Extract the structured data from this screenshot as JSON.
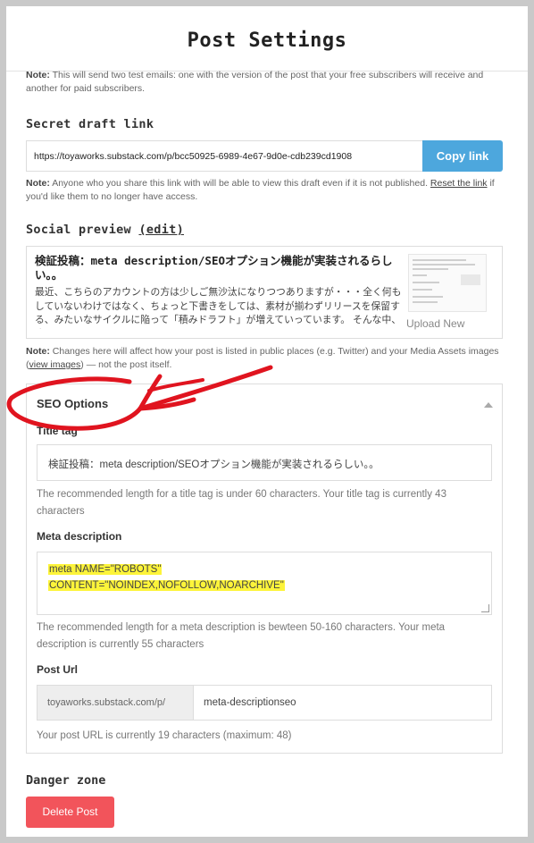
{
  "header": {
    "title": "Post Settings"
  },
  "email_note": {
    "label": "Note:",
    "text": "This will send two test emails: one with the version of the post that your free subscribers will receive and another for paid subscribers."
  },
  "secret_draft": {
    "title": "Secret draft link",
    "url": "https://toyaworks.substack.com/p/bcc50925-6989-4e67-9d0e-cdb239cd1908",
    "copy_label": "Copy link",
    "note_label": "Note:",
    "note_text_1": "Anyone who you share this link with will be able to view this draft even if it is not published.",
    "reset_link": "Reset the link",
    "note_text_2": "if you'd like them to no longer have access."
  },
  "social_preview": {
    "title": "Social preview",
    "edit_label": "(edit)",
    "post_title": "検証投稿：meta description/SEOオプション機能が実装されるらしい。。",
    "description": "最近、こちらのアカウントの方は少しご無沙汰になりつつありますが・・・全く何もしていないわけではなく、ちょっと下書きをしては、素材が揃わずリリースを保留する、みたいなサイクルに陥って「積みドラフト」が増えていっています。 そんな中、嗜り",
    "upload_label": "Upload New",
    "note_label": "Note:",
    "note_text_1": "Changes here will affect how your post is listed in public places (e.g. Twitter) and your Media Assets images (",
    "view_images": "view images",
    "note_text_2": ") — not the post itself."
  },
  "seo": {
    "title": "SEO Options",
    "title_tag_label": "Title tag",
    "title_tag_value": "検証投稿：meta description/SEOオプション機能が実装されるらしい。。",
    "title_tag_hint": "The recommended length for a title tag is under 60 characters. Your title tag is currently 43 characters",
    "meta_label": "Meta description",
    "meta_line_1": "meta NAME=\"ROBOTS\"",
    "meta_line_2": "CONTENT=\"NOINDEX,NOFOLLOW,NOARCHIVE\"",
    "meta_hint": "The recommended length for a meta description is bewteen 50-160 characters. Your meta description is currently 55 characters",
    "post_url_label": "Post Url",
    "url_prefix": "toyaworks.substack.com/p/",
    "url_slug": "meta-descriptionseo",
    "url_hint": "Your post URL is currently 19 characters (maximum: 48)"
  },
  "danger": {
    "title": "Danger zone",
    "delete_label": "Delete Post"
  },
  "colors": {
    "accent_blue": "#4da7dd",
    "danger_red": "#f2545b",
    "highlight_yellow": "#fdf43a",
    "annotation_red": "#e0141f"
  }
}
